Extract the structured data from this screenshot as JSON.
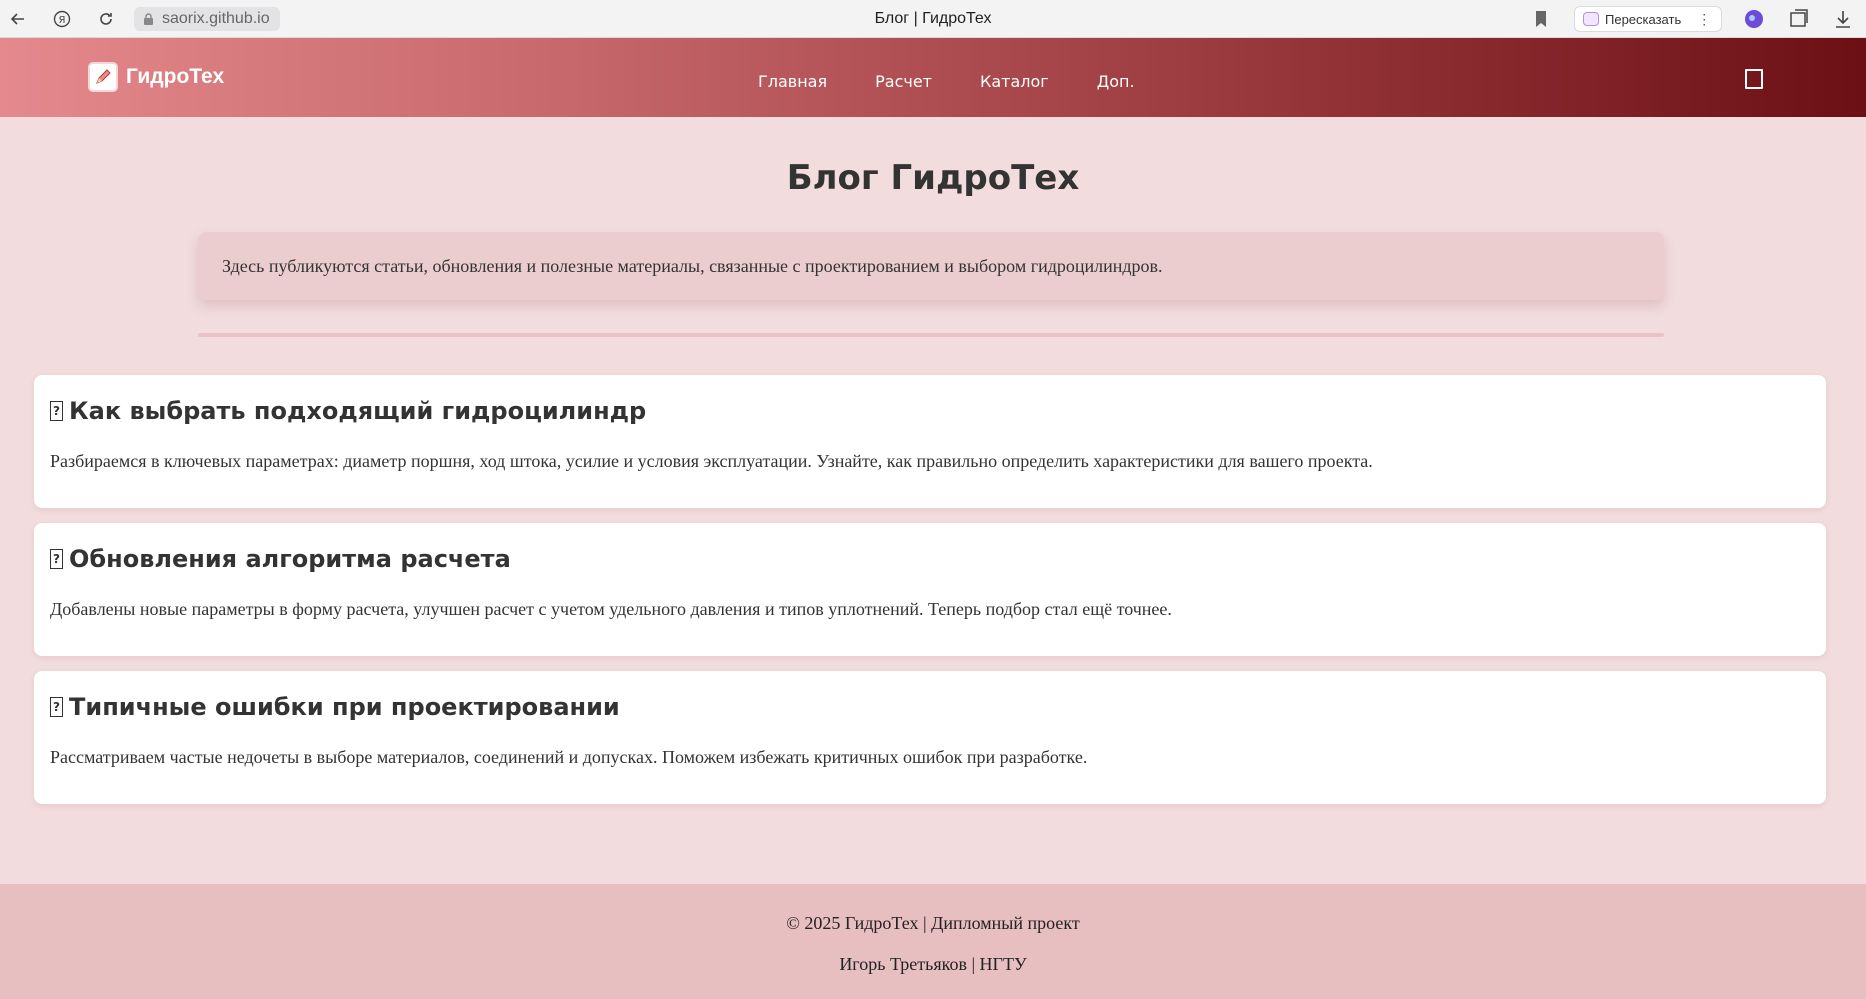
{
  "browser": {
    "url": "saorix.github.io",
    "tab_title": "Блог | ГидроТех",
    "retell_label": "Пересказать"
  },
  "header": {
    "logo_text": "ГидроТех",
    "nav": [
      {
        "label": "Главная"
      },
      {
        "label": "Расчет"
      },
      {
        "label": "Каталог"
      },
      {
        "label": "Доп."
      }
    ]
  },
  "main": {
    "title": "Блог ГидроТех",
    "intro": "Здесь публикуются статьи, обновления и полезные материалы, связанные с проектированием и выбором гидроцилиндров.",
    "posts": [
      {
        "icon": "?",
        "title": "Как выбрать подходящий гидроцилиндр",
        "text": "Разбираемся в ключевых параметрах: диаметр поршня, ход штока, усилие и условия эксплуатации. Узнайте, как правильно определить характеристики для вашего проекта."
      },
      {
        "icon": "?",
        "title": "Обновления алгоритма расчета",
        "text": "Добавлены новые параметры в форму расчета, улучшен расчет с учетом удельного давления и типов уплотнений. Теперь подбор стал ещё точнее."
      },
      {
        "icon": "?",
        "title": "Типичные ошибки при проектировании",
        "text": "Рассматриваем частые недочеты в выборе материалов, соединений и допусках. Поможем избежать критичных ошибок при разработке."
      }
    ]
  },
  "footer": {
    "line1": "© 2025 ГидроТех | Дипломный проект",
    "line2": "Игорь Третьяков | НГТУ"
  },
  "colors": {
    "page_bg": "#f2dcdd",
    "header_start": "#e4898d",
    "header_end": "#6c1015",
    "footer_bg": "#e8bfc1"
  }
}
